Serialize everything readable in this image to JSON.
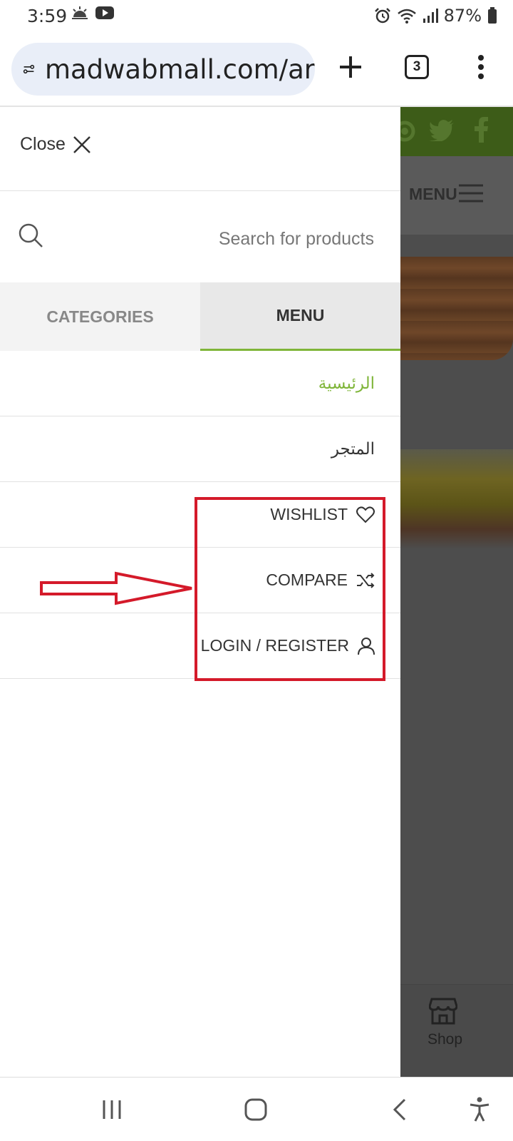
{
  "status_bar": {
    "time": "3:59",
    "battery": "87%",
    "icons": [
      "sunrise-icon",
      "youtube-icon",
      "alarm-icon",
      "wifi-icon",
      "signal-icon",
      "battery-icon"
    ]
  },
  "browser": {
    "url": "madwabmall.com/ar",
    "tab_count": "3",
    "icons": [
      "site-info-icon",
      "new-tab-icon",
      "tabs-icon",
      "more-icon"
    ]
  },
  "background_page": {
    "menu_label": "MENU",
    "shop_label": "Shop",
    "icons": [
      "instagram-icon",
      "twitter-icon",
      "facebook-icon",
      "hamburger-icon",
      "store-icon"
    ]
  },
  "drawer": {
    "close_label": "Close",
    "search_placeholder": "Search for products",
    "tabs": [
      {
        "label": "CATEGORIES",
        "active": false
      },
      {
        "label": "MENU",
        "active": true
      }
    ],
    "items": [
      {
        "label": "الرئيسية",
        "active": true
      },
      {
        "label": "المتجر",
        "active": false
      },
      {
        "label": "WISHLIST",
        "icon": "heart-icon"
      },
      {
        "label": "COMPARE",
        "icon": "shuffle-icon"
      },
      {
        "label": "LOGIN / REGISTER",
        "icon": "user-icon"
      }
    ]
  },
  "colors": {
    "accent": "#7fb539",
    "annotation": "#d41a2a",
    "url_pill": "#e9eef8"
  }
}
